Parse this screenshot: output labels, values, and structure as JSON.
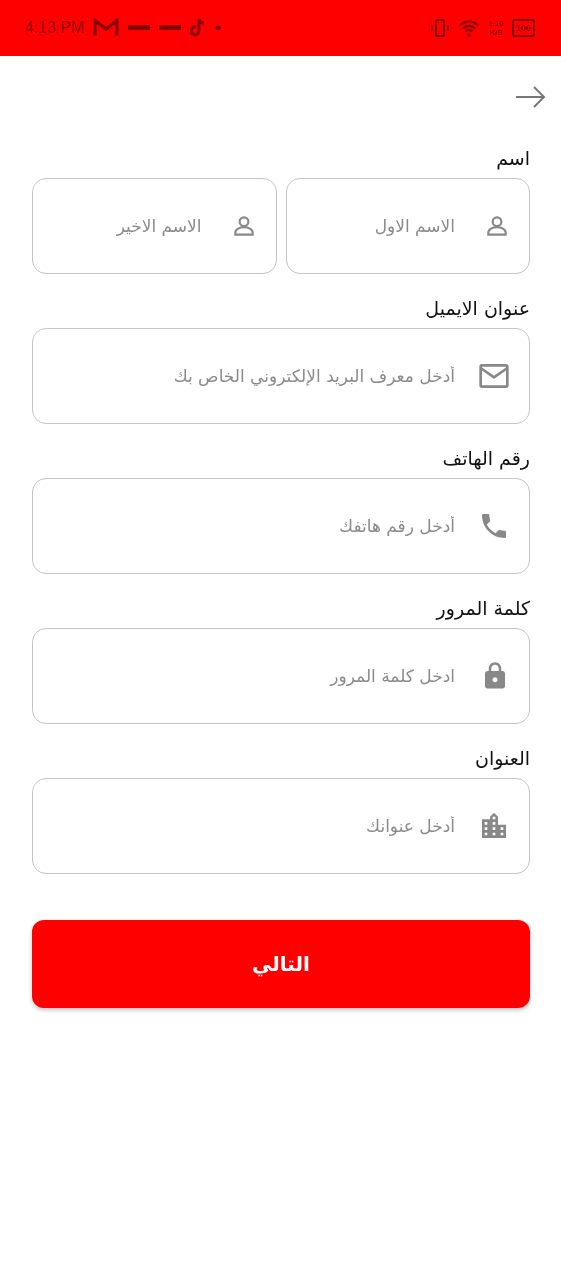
{
  "status_bar": {
    "time": "4:13 PM",
    "net_speed": "1.10",
    "net_unit": "K/S",
    "battery": "100"
  },
  "sections": [
    {
      "label": "اسم",
      "fields": [
        {
          "kind": "name",
          "placeholder": "الاسم الاول"
        },
        {
          "kind": "name",
          "placeholder": "الاسم الاخير"
        }
      ]
    },
    {
      "label": "عنوان الايميل",
      "fields": [
        {
          "kind": "email",
          "placeholder": "أدخل معرف البريد الإلكتروني الخاص بك"
        }
      ]
    },
    {
      "label": "رقم الهاتف",
      "fields": [
        {
          "kind": "phone",
          "placeholder": "أدخل رقم هاتفك"
        }
      ]
    },
    {
      "label": "كلمة المرور",
      "fields": [
        {
          "kind": "password",
          "placeholder": "ادخل كلمة المرور"
        }
      ]
    },
    {
      "label": "العنوان",
      "fields": [
        {
          "kind": "address",
          "placeholder": "أدخل عنوانك"
        }
      ]
    }
  ],
  "next_button": "التالي"
}
